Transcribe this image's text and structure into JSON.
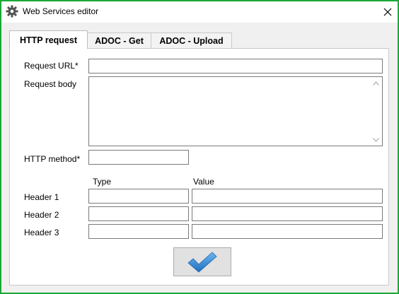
{
  "window": {
    "title": "Web Services editor",
    "accent_color": "#1aa836",
    "icon": "gear-icon",
    "close_icon": "close-icon"
  },
  "tabs": [
    {
      "label": "HTTP request",
      "active": true
    },
    {
      "label": "ADOC - Get",
      "active": false
    },
    {
      "label": "ADOC - Upload",
      "active": false
    }
  ],
  "form": {
    "request_url_label": "Request URL*",
    "request_url_value": "",
    "request_body_label": "Request body",
    "request_body_value": "",
    "http_method_label": "HTTP method*",
    "http_method_value": "",
    "type_header": "Type",
    "value_header": "Value",
    "headers": [
      {
        "label": "Header 1",
        "type": "",
        "value": ""
      },
      {
        "label": "Header 2",
        "type": "",
        "value": ""
      },
      {
        "label": "Header 3",
        "type": "",
        "value": ""
      }
    ]
  },
  "ok_button": {
    "icon": "checkmark-icon",
    "color": "#2a86d6"
  }
}
